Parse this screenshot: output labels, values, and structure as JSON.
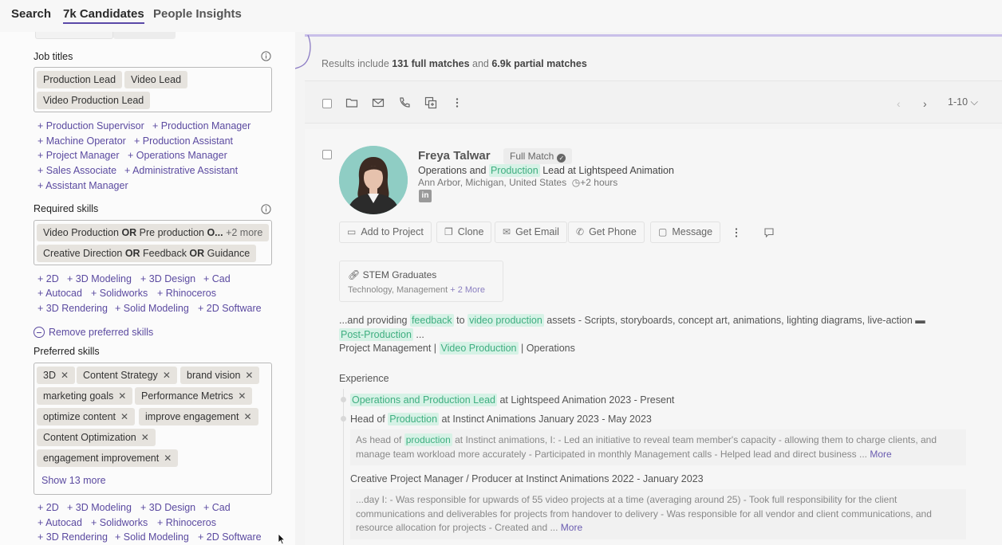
{
  "nav": {
    "tabs": [
      {
        "label": "Search"
      },
      {
        "label": "7k Candidates"
      },
      {
        "label": "People Insights"
      }
    ]
  },
  "filters": {
    "job_titles": {
      "label": "Job titles",
      "chips": [
        "Production Lead",
        "Video Lead",
        "Video Production Lead"
      ],
      "suggestions": [
        "+ Production Supervisor",
        "+ Production Manager",
        "+ Machine Operator",
        "+ Production Assistant",
        "+ Project Manager",
        "+ Operations Manager",
        "+ Sales Associate",
        "+ Administrative Assistant",
        "+ Assistant Manager"
      ]
    },
    "required_skills": {
      "label": "Required skills",
      "chip1": {
        "a": "Video Production ",
        "op1": "OR",
        "b": " Pre production ",
        "op2": "O...",
        "more": " +2 more"
      },
      "chip2": {
        "a": "Creative Direction ",
        "op1": "OR",
        "b": " Feedback ",
        "op2": "OR",
        "c": " Guidance"
      },
      "suggestions": [
        "+ 2D",
        "+ 3D Modeling",
        "+ 3D Design",
        "+ Cad",
        "+ Autocad",
        "+ Solidworks",
        "+ Rhinoceros",
        "+ 3D Rendering",
        "+ Solid Modeling",
        "+ 2D Software"
      ]
    },
    "remove_preferred_label": "Remove preferred skills",
    "preferred_skills": {
      "label": "Preferred skills",
      "chips": [
        "3D",
        "Content Strategy",
        "brand vision",
        "marketing goals",
        "Performance Metrics",
        "optimize content",
        "improve engagement",
        "Content Optimization",
        "engagement improvement"
      ],
      "show_more": "Show 13 more",
      "suggestions": [
        "+ 2D",
        "+ 3D Modeling",
        "+ 3D Design",
        "+ Cad",
        "+ Autocad",
        "+ Solidworks",
        "+ Rhinoceros",
        "+ 3D Rendering",
        "+ Solid Modeling",
        "+ 2D Software"
      ]
    }
  },
  "results": {
    "summary": {
      "prefix": "Results include ",
      "full": "131 full matches",
      "mid": " and ",
      "partial": "6.9k partial matches"
    },
    "pager": {
      "prev": "‹",
      "next": "›",
      "range": "1-10 ⌵"
    }
  },
  "candidate": {
    "name": "Freya Talwar",
    "match": "Full Match",
    "headline": {
      "a": "Operations and ",
      "hl": "Production",
      "b": " Lead at Lightspeed Animation"
    },
    "location": "Ann Arbor, Michigan, United States",
    "time": "+2 hours",
    "linkedin": "in",
    "actions": [
      "Add to Project",
      "Clone",
      "Get Email",
      "Get Phone",
      "Message"
    ],
    "tag": {
      "title": "STEM Graduates",
      "sub": "Technology, Management",
      "more": "+ 2 More"
    },
    "snippet": {
      "a": "...and providing ",
      "h1": "feedback",
      "b": " to ",
      "h2": "video production",
      "c": " assets - Scripts, storyboards, concept art, animations, lighting diagrams, live-action ",
      "h3": "Post-Production",
      "d": " ...",
      "e": "Project Management | ",
      "h4": "Video Production",
      "f": " | Operations"
    },
    "experience": {
      "title": "Experience",
      "item1": {
        "hl": "Operations and Production Lead",
        "rest": " at Lightspeed Animation 2023 - Present"
      },
      "item2": {
        "a": "Head of ",
        "hl": "Production",
        "rest": " at Instinct Animations January 2023 - May 2023"
      },
      "desc2": {
        "a": "As head of ",
        "hl": "production",
        "b": " at Instinct animations, I: - Led an initiative to reveal team member's capacity - allowing them to charge clients, and manage team workload more accurately - Participated in monthly Management calls - Helped lead and direct business ... ",
        "more": "More"
      },
      "item3": "Creative Project Manager / Producer at Instinct Animations 2022 - January 2023",
      "desc3": {
        "a": "...day I: - Was responsible for upwards of 55 video projects at a time (averaging around 25) - Took full responsibility for the client communications and deliverables for projects from handover to delivery - Was responsible for all vendor and client communications, and resource allocation for projects - Created and ... ",
        "more": "More"
      }
    }
  }
}
